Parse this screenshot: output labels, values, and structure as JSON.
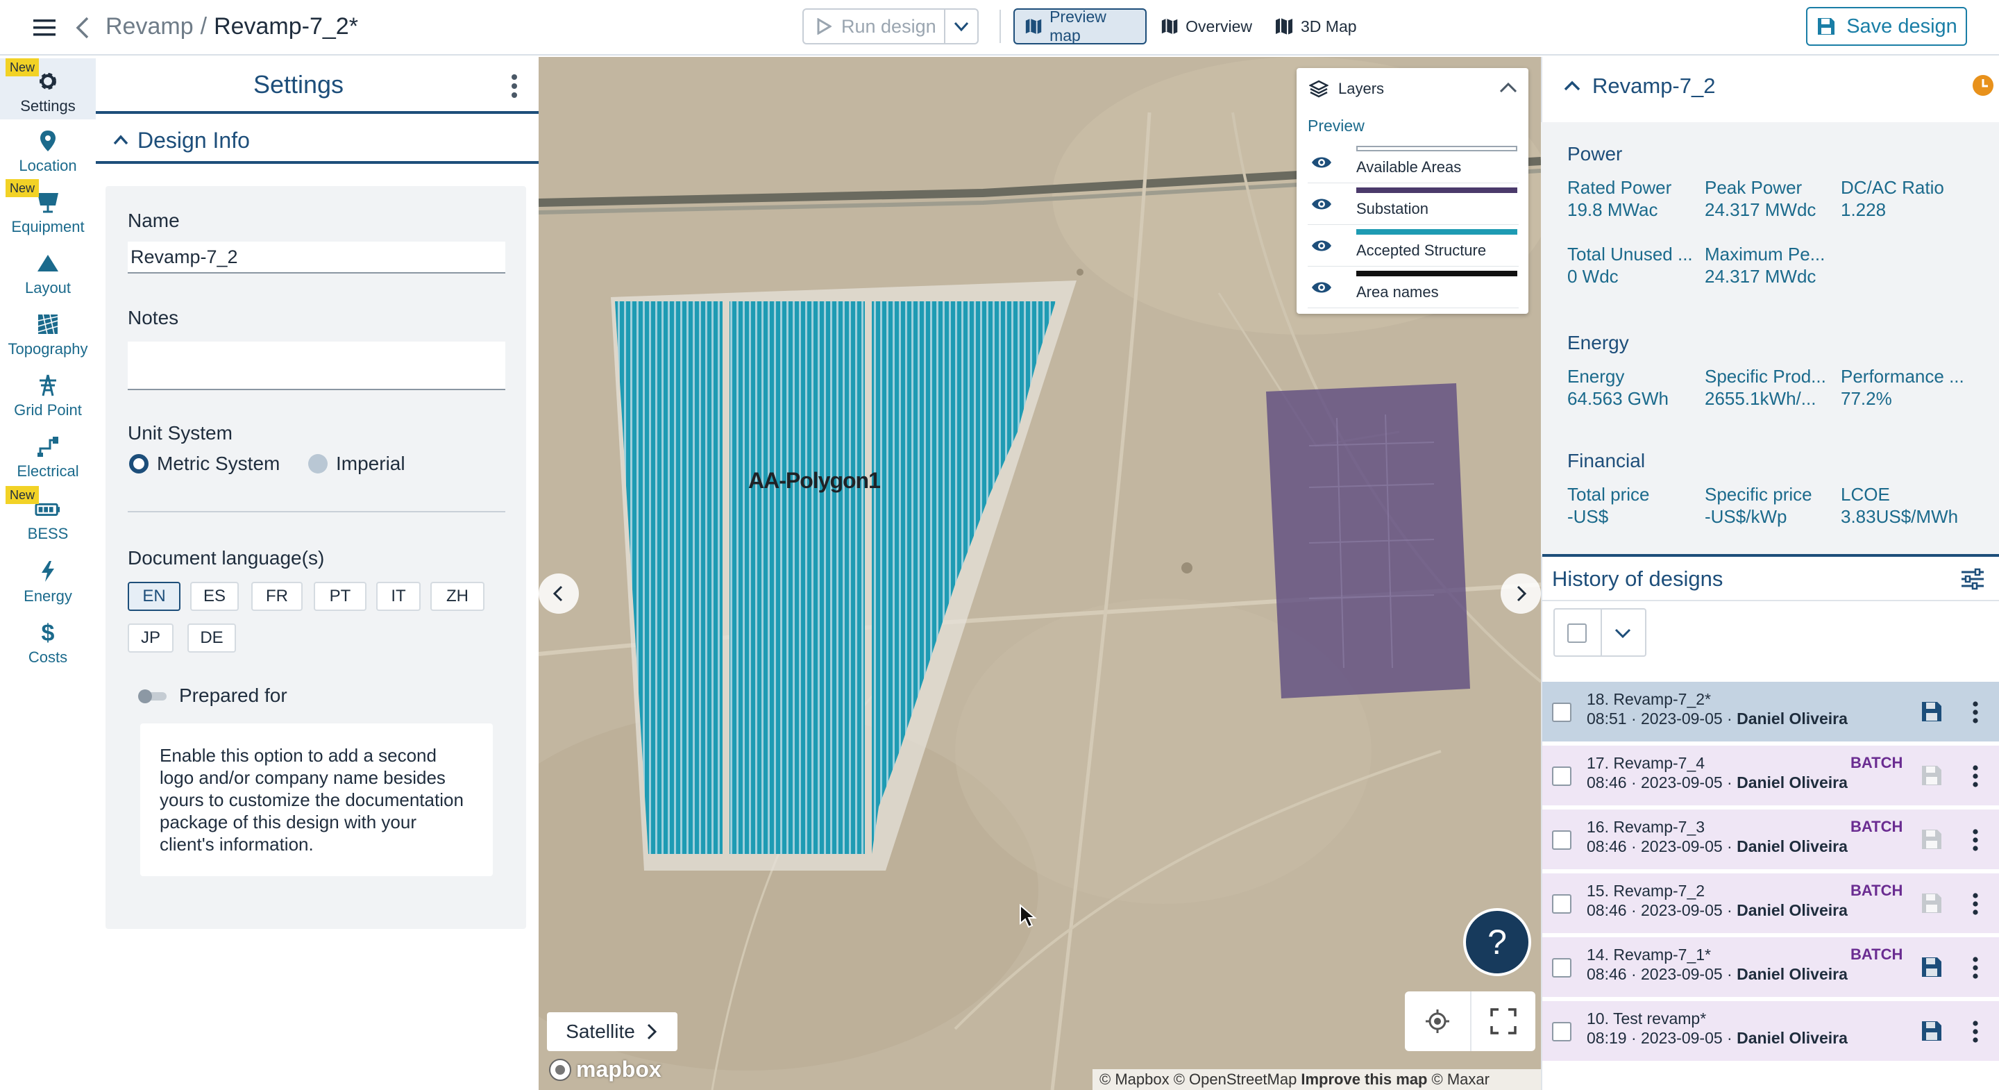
{
  "header": {
    "project": "Revamp",
    "separator": "/",
    "design": "Revamp-7_2*",
    "run_design": "Run design",
    "views": [
      {
        "label": "Preview map",
        "active": true
      },
      {
        "label": "Overview",
        "active": false
      },
      {
        "label": "3D Map",
        "active": false
      }
    ],
    "save_design": "Save design"
  },
  "nav": {
    "new_badge": "New",
    "items": [
      {
        "label": "Settings",
        "icon": "gear-icon",
        "active": true,
        "badge": true
      },
      {
        "label": "Location",
        "icon": "map-pin-icon",
        "active": false,
        "badge": false
      },
      {
        "label": "Equipment",
        "icon": "solar-panel-icon",
        "active": false,
        "badge": true
      },
      {
        "label": "Layout",
        "icon": "mountain-icon",
        "active": false,
        "badge": false
      },
      {
        "label": "Topography",
        "icon": "terrain-icon",
        "active": false,
        "badge": false
      },
      {
        "label": "Grid Point",
        "icon": "transmission-tower-icon",
        "active": false,
        "badge": false
      },
      {
        "label": "Electrical",
        "icon": "cable-icon",
        "active": false,
        "badge": false
      },
      {
        "label": "BESS",
        "icon": "battery-icon",
        "active": false,
        "badge": true
      },
      {
        "label": "Energy",
        "icon": "lightning-icon",
        "active": false,
        "badge": false
      },
      {
        "label": "Costs",
        "icon": "dollar-icon",
        "active": false,
        "badge": false
      }
    ]
  },
  "settings": {
    "title": "Settings",
    "section": "Design Info",
    "name_label": "Name",
    "name_value": "Revamp-7_2",
    "notes_label": "Notes",
    "notes_value": "",
    "unit_label": "Unit System",
    "unit_options": [
      "Metric System",
      "Imperial"
    ],
    "unit_selected": "Metric System",
    "lang_label": "Document language(s)",
    "languages": [
      "EN",
      "ES",
      "FR",
      "PT",
      "IT",
      "ZH",
      "JP",
      "DE"
    ],
    "lang_selected": "EN",
    "prepared_for_label": "Prepared for",
    "prepared_for_enabled": false,
    "prepared_for_info": "Enable this option to add a second logo and/or company name besides yours to customize the documentation package of this design with your client's information."
  },
  "map": {
    "polygon_label": "AA-Polygon1",
    "layers_title": "Layers",
    "preview_label": "Preview",
    "layers": [
      {
        "name": "Available Areas",
        "color": "#ffffff"
      },
      {
        "name": "Substation",
        "color": "#4b3a6b"
      },
      {
        "name": "Accepted Structure",
        "color": "#1e9bb3"
      },
      {
        "name": "Area names",
        "color": "#111111"
      }
    ],
    "satellite_label": "Satellite",
    "help_label": "?",
    "logo": "mapbox",
    "attribution": {
      "part1": "© Mapbox © OpenStreetMap",
      "improve": "Improve this map",
      "part2": "© Maxar"
    },
    "colors": {
      "structure": "#1e9bb3",
      "substation": "#5c4a80"
    }
  },
  "summary": {
    "title": "Revamp-7_2",
    "sections": [
      {
        "title": "Power",
        "rows": [
          [
            {
              "label": "Rated Power",
              "value": "19.8 MWac"
            },
            {
              "label": "Peak Power",
              "value": "24.317 MWdc"
            },
            {
              "label": "DC/AC Ratio",
              "value": "1.228"
            }
          ],
          [
            {
              "label": "Total Unused ...",
              "value": "0 Wdc"
            },
            {
              "label": "Maximum Pe...",
              "value": "24.317 MWdc"
            }
          ]
        ]
      },
      {
        "title": "Energy",
        "rows": [
          [
            {
              "label": "Energy",
              "value": "64.563 GWh"
            },
            {
              "label": "Specific Prod...",
              "value": "2655.1kWh/..."
            },
            {
              "label": "Performance ...",
              "value": "77.2%"
            }
          ]
        ]
      },
      {
        "title": "Financial",
        "rows": [
          [
            {
              "label": "Total price",
              "value": "-US$"
            },
            {
              "label": "Specific price",
              "value": "-US$/kWp"
            },
            {
              "label": "LCOE",
              "value": "3.83US$/MWh"
            }
          ]
        ]
      }
    ]
  },
  "history": {
    "title": "History of designs",
    "batch_label": "BATCH",
    "items": [
      {
        "name": "18. Revamp-7_2*",
        "time": "08:51 · 2023-09-05 · ",
        "author": "Daniel Oliveira",
        "batch": false,
        "saved": true,
        "selected": true
      },
      {
        "name": "17. Revamp-7_4",
        "time": "08:46 · 2023-09-05 · ",
        "author": "Daniel Oliveira",
        "batch": true,
        "saved": false,
        "selected": false
      },
      {
        "name": "16. Revamp-7_3",
        "time": "08:46 · 2023-09-05 · ",
        "author": "Daniel Oliveira",
        "batch": true,
        "saved": false,
        "selected": false
      },
      {
        "name": "15. Revamp-7_2",
        "time": "08:46 · 2023-09-05 · ",
        "author": "Daniel Oliveira",
        "batch": true,
        "saved": false,
        "selected": false
      },
      {
        "name": "14. Revamp-7_1*",
        "time": "08:46 · 2023-09-05 · ",
        "author": "Daniel Oliveira",
        "batch": true,
        "saved": true,
        "selected": false
      },
      {
        "name": "10. Test revamp*",
        "time": "08:19 · 2023-09-05 · ",
        "author": "Daniel Oliveira",
        "batch": false,
        "saved": true,
        "selected": false
      }
    ]
  }
}
